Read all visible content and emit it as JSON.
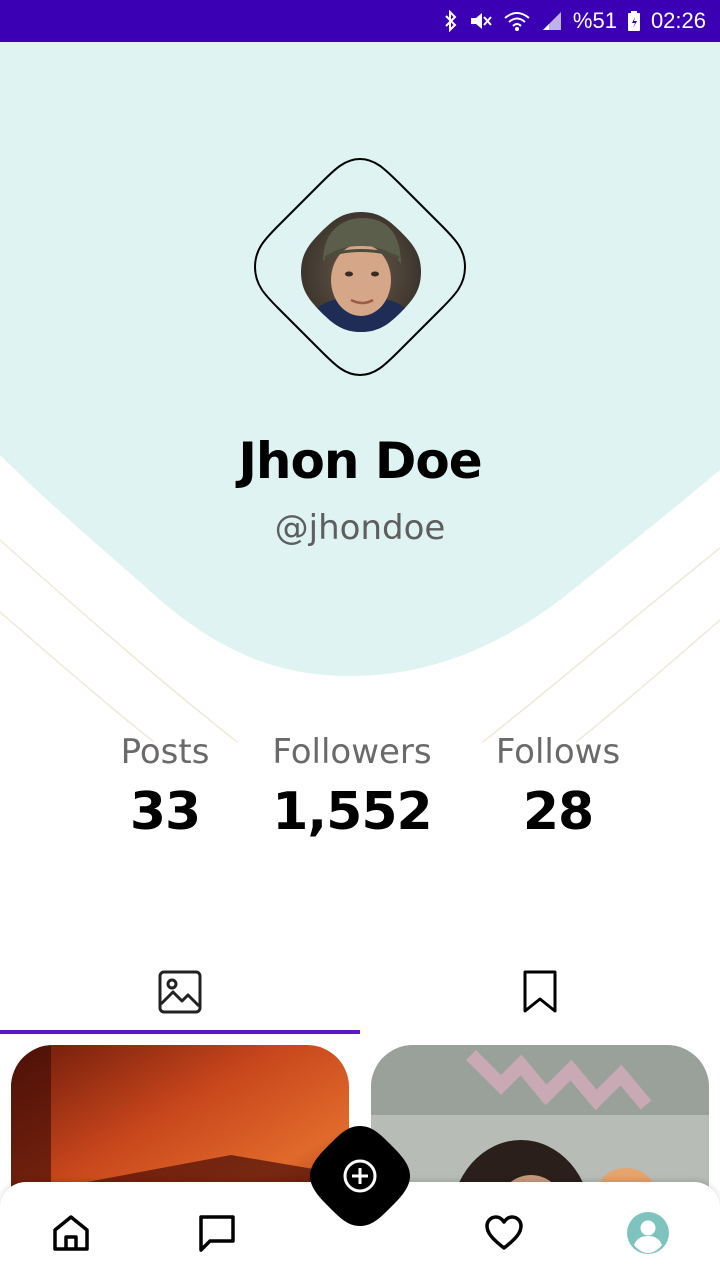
{
  "status_bar": {
    "battery": "%51",
    "time": "02:26",
    "background_color": "#3b00b4"
  },
  "profile": {
    "name": "Jhon Doe",
    "handle": "@jhondoe",
    "header_color": "#dff3f2"
  },
  "stats": [
    {
      "label": "Posts",
      "value": "33"
    },
    {
      "label": "Followers",
      "value": "1,552"
    },
    {
      "label": "Follows",
      "value": "28"
    }
  ],
  "tabs": [
    {
      "icon": "image-icon",
      "active": true
    },
    {
      "icon": "bookmark-icon",
      "active": false
    }
  ],
  "accent_color": "#5b17c8",
  "bottom_nav": [
    {
      "icon": "home-icon"
    },
    {
      "icon": "chat-icon"
    },
    {
      "icon": "add-circle-icon"
    },
    {
      "icon": "heart-icon"
    },
    {
      "icon": "profile-icon",
      "active": true
    }
  ]
}
